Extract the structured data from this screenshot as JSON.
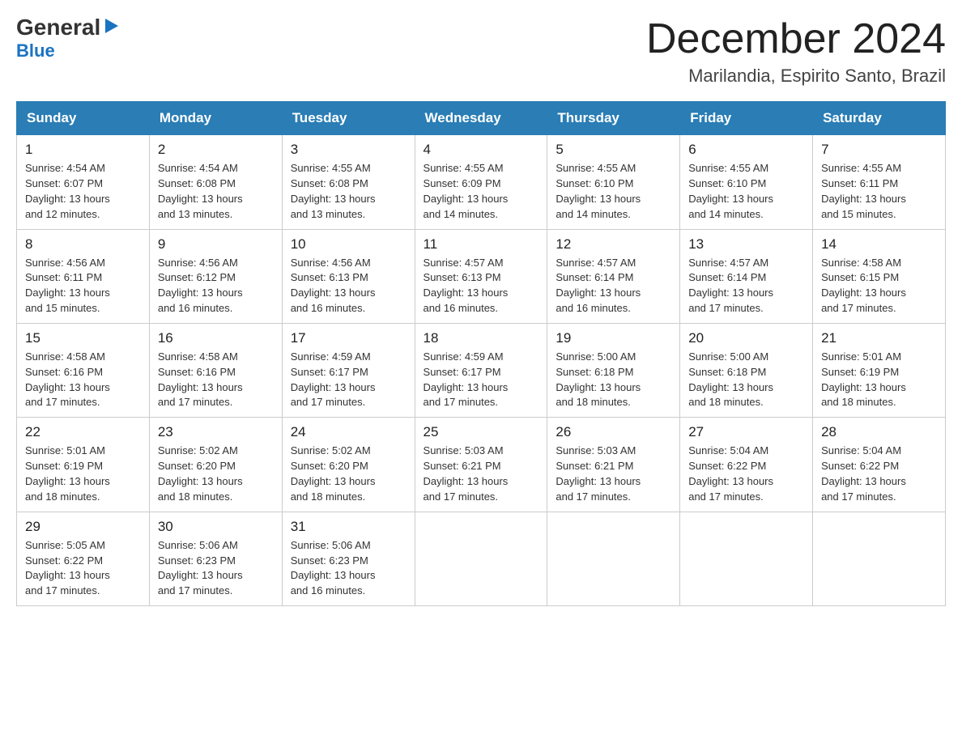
{
  "logo": {
    "general": "General",
    "blue": "Blue",
    "triangle": "▶"
  },
  "title": {
    "month": "December 2024",
    "location": "Marilandia, Espirito Santo, Brazil"
  },
  "weekdays": [
    "Sunday",
    "Monday",
    "Tuesday",
    "Wednesday",
    "Thursday",
    "Friday",
    "Saturday"
  ],
  "weeks": [
    [
      {
        "day": "1",
        "sunrise": "4:54 AM",
        "sunset": "6:07 PM",
        "daylight": "13 hours and 12 minutes."
      },
      {
        "day": "2",
        "sunrise": "4:54 AM",
        "sunset": "6:08 PM",
        "daylight": "13 hours and 13 minutes."
      },
      {
        "day": "3",
        "sunrise": "4:55 AM",
        "sunset": "6:08 PM",
        "daylight": "13 hours and 13 minutes."
      },
      {
        "day": "4",
        "sunrise": "4:55 AM",
        "sunset": "6:09 PM",
        "daylight": "13 hours and 14 minutes."
      },
      {
        "day": "5",
        "sunrise": "4:55 AM",
        "sunset": "6:10 PM",
        "daylight": "13 hours and 14 minutes."
      },
      {
        "day": "6",
        "sunrise": "4:55 AM",
        "sunset": "6:10 PM",
        "daylight": "13 hours and 14 minutes."
      },
      {
        "day": "7",
        "sunrise": "4:55 AM",
        "sunset": "6:11 PM",
        "daylight": "13 hours and 15 minutes."
      }
    ],
    [
      {
        "day": "8",
        "sunrise": "4:56 AM",
        "sunset": "6:11 PM",
        "daylight": "13 hours and 15 minutes."
      },
      {
        "day": "9",
        "sunrise": "4:56 AM",
        "sunset": "6:12 PM",
        "daylight": "13 hours and 16 minutes."
      },
      {
        "day": "10",
        "sunrise": "4:56 AM",
        "sunset": "6:13 PM",
        "daylight": "13 hours and 16 minutes."
      },
      {
        "day": "11",
        "sunrise": "4:57 AM",
        "sunset": "6:13 PM",
        "daylight": "13 hours and 16 minutes."
      },
      {
        "day": "12",
        "sunrise": "4:57 AM",
        "sunset": "6:14 PM",
        "daylight": "13 hours and 16 minutes."
      },
      {
        "day": "13",
        "sunrise": "4:57 AM",
        "sunset": "6:14 PM",
        "daylight": "13 hours and 17 minutes."
      },
      {
        "day": "14",
        "sunrise": "4:58 AM",
        "sunset": "6:15 PM",
        "daylight": "13 hours and 17 minutes."
      }
    ],
    [
      {
        "day": "15",
        "sunrise": "4:58 AM",
        "sunset": "6:16 PM",
        "daylight": "13 hours and 17 minutes."
      },
      {
        "day": "16",
        "sunrise": "4:58 AM",
        "sunset": "6:16 PM",
        "daylight": "13 hours and 17 minutes."
      },
      {
        "day": "17",
        "sunrise": "4:59 AM",
        "sunset": "6:17 PM",
        "daylight": "13 hours and 17 minutes."
      },
      {
        "day": "18",
        "sunrise": "4:59 AM",
        "sunset": "6:17 PM",
        "daylight": "13 hours and 17 minutes."
      },
      {
        "day": "19",
        "sunrise": "5:00 AM",
        "sunset": "6:18 PM",
        "daylight": "13 hours and 18 minutes."
      },
      {
        "day": "20",
        "sunrise": "5:00 AM",
        "sunset": "6:18 PM",
        "daylight": "13 hours and 18 minutes."
      },
      {
        "day": "21",
        "sunrise": "5:01 AM",
        "sunset": "6:19 PM",
        "daylight": "13 hours and 18 minutes."
      }
    ],
    [
      {
        "day": "22",
        "sunrise": "5:01 AM",
        "sunset": "6:19 PM",
        "daylight": "13 hours and 18 minutes."
      },
      {
        "day": "23",
        "sunrise": "5:02 AM",
        "sunset": "6:20 PM",
        "daylight": "13 hours and 18 minutes."
      },
      {
        "day": "24",
        "sunrise": "5:02 AM",
        "sunset": "6:20 PM",
        "daylight": "13 hours and 18 minutes."
      },
      {
        "day": "25",
        "sunrise": "5:03 AM",
        "sunset": "6:21 PM",
        "daylight": "13 hours and 17 minutes."
      },
      {
        "day": "26",
        "sunrise": "5:03 AM",
        "sunset": "6:21 PM",
        "daylight": "13 hours and 17 minutes."
      },
      {
        "day": "27",
        "sunrise": "5:04 AM",
        "sunset": "6:22 PM",
        "daylight": "13 hours and 17 minutes."
      },
      {
        "day": "28",
        "sunrise": "5:04 AM",
        "sunset": "6:22 PM",
        "daylight": "13 hours and 17 minutes."
      }
    ],
    [
      {
        "day": "29",
        "sunrise": "5:05 AM",
        "sunset": "6:22 PM",
        "daylight": "13 hours and 17 minutes."
      },
      {
        "day": "30",
        "sunrise": "5:06 AM",
        "sunset": "6:23 PM",
        "daylight": "13 hours and 17 minutes."
      },
      {
        "day": "31",
        "sunrise": "5:06 AM",
        "sunset": "6:23 PM",
        "daylight": "13 hours and 16 minutes."
      },
      null,
      null,
      null,
      null
    ]
  ],
  "labels": {
    "sunrise": "Sunrise:",
    "sunset": "Sunset:",
    "daylight": "Daylight:"
  }
}
